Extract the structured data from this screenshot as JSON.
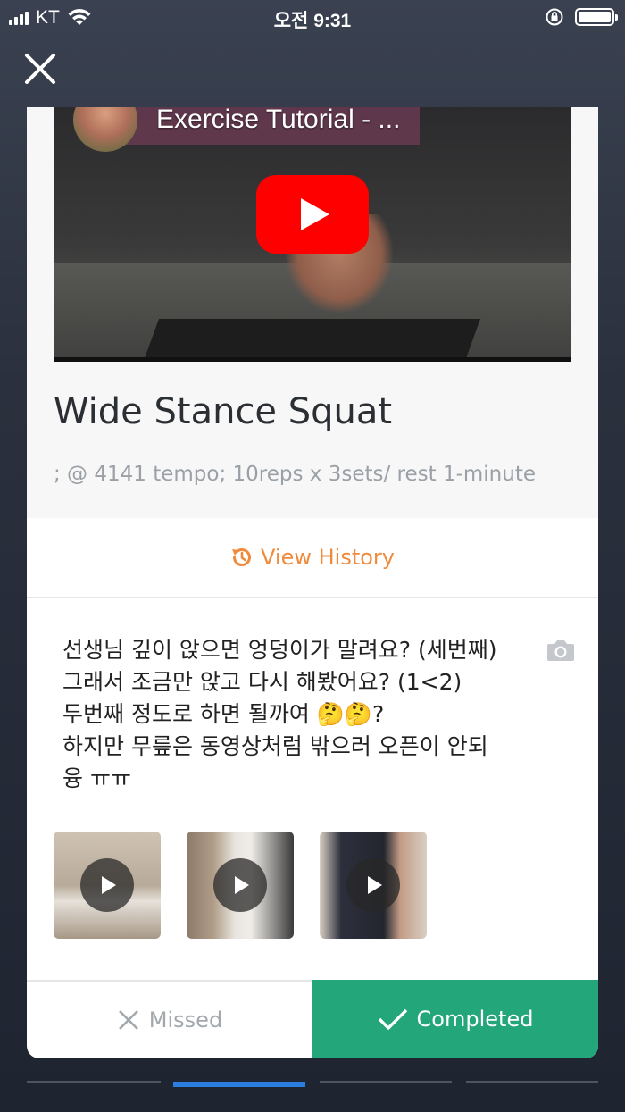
{
  "status_bar": {
    "carrier": "KT",
    "time": "오전 9:31"
  },
  "video": {
    "title": "Exercise Tutorial - ..."
  },
  "exercise": {
    "title": "Wide Stance Squat",
    "subtitle": "; @ 4141 tempo; 10reps x 3sets/ rest 1-minute"
  },
  "history": {
    "label": "View History"
  },
  "note": {
    "lines": [
      "선생님 깊이 앉으면 엉덩이가 말려요? (세번째)",
      "그래서 조금만 앉고 다시 해봤어요? (1<2)",
      "두번째 정도로 하면 될까여 🤔🤔?",
      "하지만 무릎은 동영상처럼 밖으러 오픈이 안되",
      "융 ㅠㅠ"
    ]
  },
  "actions": {
    "missed_label": "Missed",
    "completed_label": "Completed"
  },
  "colors": {
    "accent_orange": "#f08a3c",
    "completed_green": "#23a679",
    "pager_active": "#2c7de0"
  },
  "pager": {
    "count": 4,
    "active_index": 1
  }
}
